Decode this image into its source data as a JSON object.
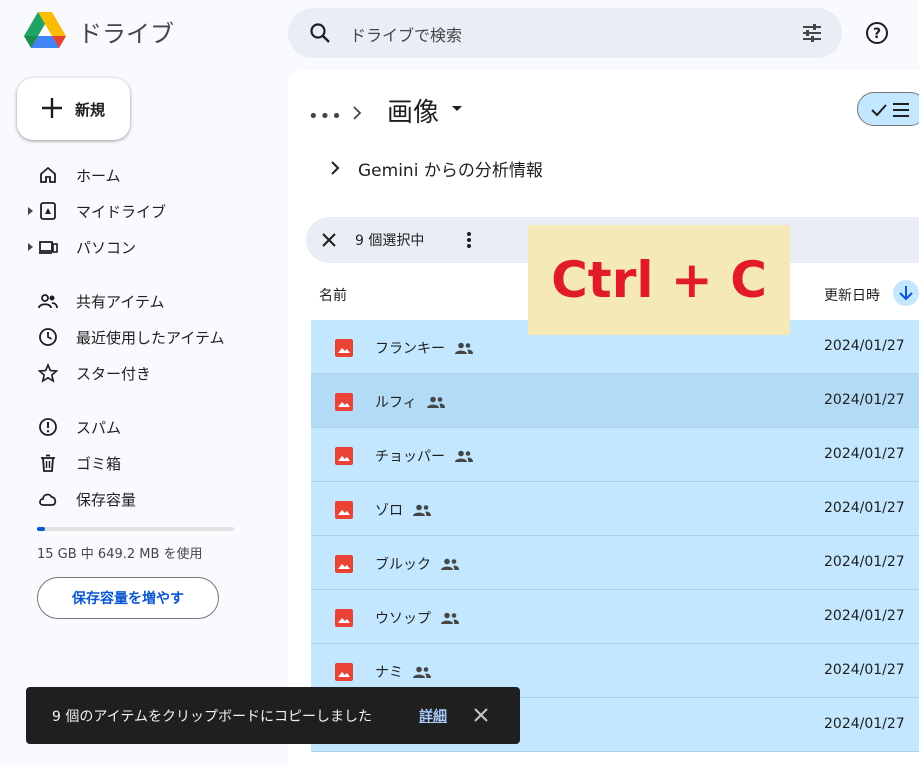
{
  "app": {
    "name": "ドライブ",
    "search_placeholder": "ドライブで検索"
  },
  "sidebar": {
    "new_label": "新規",
    "items": [
      {
        "label": "ホーム",
        "icon": "home-icon"
      },
      {
        "label": "マイドライブ",
        "icon": "my-drive-icon"
      },
      {
        "label": "パソコン",
        "icon": "computer-icon"
      },
      {
        "label": "共有アイテム",
        "icon": "people-icon"
      },
      {
        "label": "最近使用したアイテム",
        "icon": "clock-icon"
      },
      {
        "label": "スター付き",
        "icon": "star-icon"
      },
      {
        "label": "スパム",
        "icon": "spam-icon"
      },
      {
        "label": "ゴミ箱",
        "icon": "trash-icon"
      },
      {
        "label": "保存容量",
        "icon": "cloud-icon"
      }
    ],
    "storage_used_fraction": 0.04,
    "storage_text": "15 GB 中 649.2 MB を使用",
    "storage_button": "保存容量を増やす"
  },
  "breadcrumb": {
    "more": "•••",
    "title": "画像"
  },
  "gemini_label": "Gemini からの分析情報",
  "selection": {
    "count_text": "9 個選択中"
  },
  "columns": {
    "name": "名前",
    "modified": "更新日時"
  },
  "files": [
    {
      "name": "フランキー",
      "date": "2024/01/27"
    },
    {
      "name": "ルフィ",
      "date": "2024/01/27"
    },
    {
      "name": "チョッパー",
      "date": "2024/01/27"
    },
    {
      "name": "ゾロ",
      "date": "2024/01/27"
    },
    {
      "name": "ブルック",
      "date": "2024/01/27"
    },
    {
      "name": "ウソップ",
      "date": "2024/01/27"
    },
    {
      "name": "ナミ",
      "date": "2024/01/27"
    },
    {
      "name": "",
      "date": "2024/01/27"
    }
  ],
  "overlay_text": "Ctrl + C",
  "toast": {
    "message": "9 個のアイテムをクリップボードにコピーしました",
    "detail_link": "詳細"
  },
  "colors": {
    "selection": "#c2e7ff",
    "accent": "#0b57d0",
    "overlay_text": "#e11c24",
    "overlay_bg": "#f5e9b8"
  }
}
